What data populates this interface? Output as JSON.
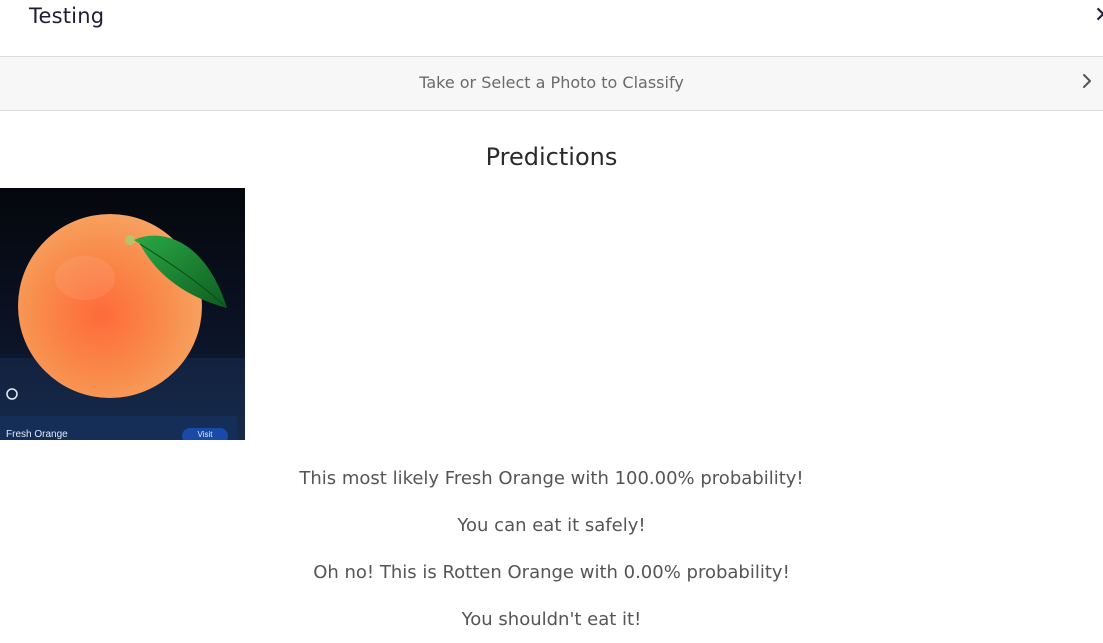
{
  "header": {
    "title": "Testing",
    "close_icon": "close-icon"
  },
  "select_bar": {
    "label": "Take or Select a Photo to Classify",
    "icon": "chevron-right-icon"
  },
  "predictions": {
    "title": "Predictions",
    "photo": {
      "caption": "Fresh Orange",
      "button_label": "Visit"
    },
    "results": [
      "This most likely Fresh Orange with 100.00% probability!",
      "You can eat it safely!",
      "Oh no! This is Rotten Orange with 0.00% probability!",
      "You shouldn't eat it!"
    ]
  },
  "colors": {
    "title_text": "#1d1d3a",
    "bar_background": "#f7f7f7",
    "body_text": "#555555",
    "orange": "#f07a3c",
    "leaf": "#1f8a32"
  }
}
